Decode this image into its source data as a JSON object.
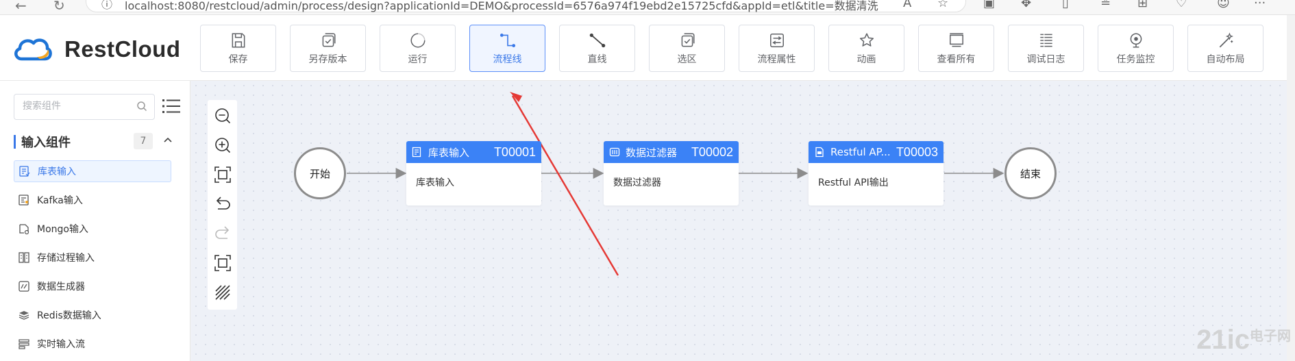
{
  "browser": {
    "url": "localhost:8080/restcloud/admin/process/design?applicationId=DEMO&processId=6576a974f19ebd2e15725cfd&appId=etl&title=数据清洗"
  },
  "app": {
    "logo_text": "RestCloud"
  },
  "toolbar": [
    {
      "label": "保存",
      "icon": "save-icon"
    },
    {
      "label": "另存版本",
      "icon": "save-version-icon"
    },
    {
      "label": "运行",
      "icon": "run-icon"
    },
    {
      "label": "流程线",
      "icon": "flow-line-icon",
      "active": true
    },
    {
      "label": "直线",
      "icon": "straight-line-icon"
    },
    {
      "label": "选区",
      "icon": "select-area-icon"
    },
    {
      "label": "流程属性",
      "icon": "properties-icon"
    },
    {
      "label": "动画",
      "icon": "animation-icon"
    },
    {
      "label": "查看所有",
      "icon": "view-all-icon"
    },
    {
      "label": "调试日志",
      "icon": "debug-log-icon"
    },
    {
      "label": "任务监控",
      "icon": "monitor-icon"
    },
    {
      "label": "自动布局",
      "icon": "auto-layout-icon"
    }
  ],
  "sidebar": {
    "search_placeholder": "搜索组件",
    "group": {
      "title": "输入组件",
      "count": "7"
    },
    "items": [
      {
        "label": "库表输入",
        "icon": "table-input-icon",
        "selected": true
      },
      {
        "label": "Kafka输入",
        "icon": "kafka-input-icon"
      },
      {
        "label": "Mongo输入",
        "icon": "mongo-input-icon"
      },
      {
        "label": "存储过程输入",
        "icon": "procedure-input-icon"
      },
      {
        "label": "数据生成器",
        "icon": "data-generator-icon"
      },
      {
        "label": "Redis数据输入",
        "icon": "redis-input-icon"
      },
      {
        "label": "实时输入流",
        "icon": "realtime-stream-icon"
      }
    ]
  },
  "canvas_tools": [
    "zoom-out-icon",
    "zoom-in-icon",
    "fit-view-icon",
    "undo-icon",
    "redo-icon",
    "fullscreen-icon",
    "grid-icon"
  ],
  "flow": {
    "start": "开始",
    "end": "结束",
    "tasks": [
      {
        "name": "库表输入",
        "id": "T00001",
        "body": "库表输入"
      },
      {
        "name": "数据过滤器",
        "id": "T00002",
        "body": "数据过滤器"
      },
      {
        "name": "Restful AP...",
        "id": "T00003",
        "body": "Restful API输出"
      }
    ]
  },
  "watermark": {
    "text": "21ic",
    "cn": "电子网"
  },
  "colors": {
    "accent": "#3b82f6",
    "annotation_arrow": "#e53935"
  }
}
